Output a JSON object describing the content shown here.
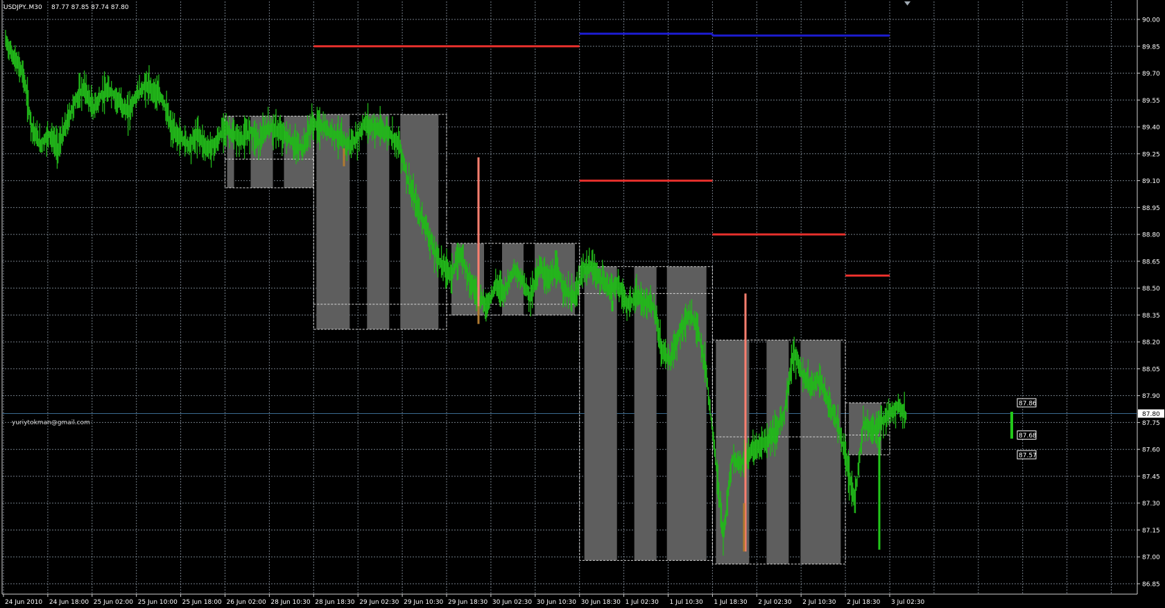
{
  "header": {
    "symbol": "USDJPY..M30",
    "quote": "87.77 87.85 87.74 87.80"
  },
  "watermark": "yuriytokman@gmail.com",
  "colors": {
    "background": "#000000",
    "grid": "#9aa7b5",
    "price_line": "#3a6a90",
    "candle": "#22b81a",
    "box_fill": "#5e5e5e",
    "level_red": "#e8302c",
    "level_blue": "#1c1cd0",
    "spike_red": "#ff7f6f",
    "spike_orange": "#b07a30",
    "spike_green": "#22c81a",
    "label_box": "#000000",
    "label_border": "#ffffff"
  },
  "chart_data": {
    "type": "candlestick",
    "title": "",
    "symbol": "USDJPY..M30",
    "ylim": [
      86.78,
      90.07
    ],
    "y_ticks": [
      90.0,
      89.85,
      89.7,
      89.55,
      89.4,
      89.25,
      89.1,
      88.95,
      88.8,
      88.65,
      88.5,
      88.35,
      88.2,
      88.05,
      87.9,
      87.75,
      87.6,
      87.45,
      87.3,
      87.15,
      87.0,
      86.85
    ],
    "y_tick_labels": [
      "90.00",
      "89.85",
      "89.70",
      "89.55",
      "89.40",
      "89.25",
      "89.10",
      "88.95",
      "88.80",
      "88.65",
      "88.50",
      "88.35",
      "88.20",
      "88.05",
      "87.90",
      "87.75",
      "87.60",
      "87.45",
      "87.30",
      "87.15",
      "87.00",
      "86.85"
    ],
    "x_labels": [
      "24 Jun 2010",
      "24 Jun 18:00",
      "25 Jun 02:00",
      "25 Jun 10:00",
      "25 Jun 18:00",
      "26 Jun 02:00",
      "28 Jun 10:30",
      "28 Jun 18:30",
      "29 Jun 02:30",
      "29 Jun 10:30",
      "29 Jun 18:30",
      "30 Jun 02:30",
      "30 Jun 10:30",
      "30 Jun 18:30",
      "1 Jul 02:30",
      "1 Jul 10:30",
      "1 Jul 18:30",
      "2 Jul 02:30",
      "2 Jul 10:30",
      "2 Jul 18:30",
      "3 Jul 02:30"
    ],
    "current_price": 87.8,
    "current_price_label": "87.80",
    "price_trace": [
      89.88,
      89.78,
      89.7,
      89.4,
      89.3,
      89.36,
      89.28,
      89.42,
      89.55,
      89.62,
      89.5,
      89.58,
      89.6,
      89.54,
      89.48,
      89.58,
      89.63,
      89.6,
      89.55,
      89.38,
      89.34,
      89.3,
      89.36,
      89.28,
      89.3,
      89.4,
      89.35,
      89.33,
      89.38,
      89.32,
      89.4,
      89.38,
      89.35,
      89.3,
      89.28,
      89.42,
      89.4,
      89.38,
      89.35,
      89.3,
      89.32,
      89.42,
      89.4,
      89.38,
      89.36,
      89.3,
      89.1,
      88.95,
      88.85,
      88.7,
      88.62,
      88.58,
      88.7,
      88.55,
      88.45,
      88.4,
      88.52,
      88.48,
      88.6,
      88.55,
      88.45,
      88.62,
      88.55,
      88.6,
      88.48,
      88.45,
      88.6,
      88.62,
      88.55,
      88.5,
      88.52,
      88.4,
      88.45,
      88.42,
      88.4,
      88.15,
      88.1,
      88.25,
      88.35,
      88.3,
      88.05,
      87.6,
      87.1,
      87.55,
      87.52,
      87.58,
      87.62,
      87.65,
      87.7,
      87.8,
      88.15,
      88.02,
      87.95,
      88.0,
      87.85,
      87.75,
      87.55,
      87.3,
      87.75,
      87.7,
      87.75,
      87.8,
      87.84,
      87.78
    ],
    "ranges": [
      {
        "from": "26 Jun 02:00",
        "to": "28 Jun 18:30",
        "high": 89.46,
        "low": 89.06,
        "mid": 89.22
      },
      {
        "from": "28 Jun 18:30",
        "to": "29 Jun 18:30",
        "high": 89.47,
        "low": 88.27,
        "mid": 88.41
      },
      {
        "from": "29 Jun 18:30",
        "to": "30 Jun 18:30",
        "high": 88.75,
        "low": 88.35,
        "mid": 88.41
      },
      {
        "from": "30 Jun 18:30",
        "to": "1 Jul 18:30",
        "high": 88.62,
        "low": 86.98,
        "mid": 88.47
      },
      {
        "from": "1 Jul 18:30",
        "to": "2 Jul 18:30",
        "high": 88.21,
        "low": 86.96,
        "mid": 87.67
      },
      {
        "from": "2 Jul 18:30",
        "to": "3 Jul 02:30",
        "high": 87.86,
        "low": 87.57,
        "mid": 87.68
      }
    ],
    "range_labels": [
      "87.86",
      "87.68",
      "87.57"
    ],
    "levels": [
      {
        "color": "red",
        "value": 89.85,
        "from": "28 Jun 18:30",
        "to": "30 Jun 18:30"
      },
      {
        "color": "blue",
        "value": 89.92,
        "from": "30 Jun 18:30",
        "to": "1 Jul 18:30"
      },
      {
        "color": "blue",
        "value": 89.91,
        "from": "1 Jul 18:30",
        "to": "3 Jul 02:30"
      },
      {
        "color": "red",
        "value": 89.1,
        "from": "30 Jun 18:30",
        "to": "1 Jul 18:30"
      },
      {
        "color": "red",
        "value": 88.8,
        "from": "1 Jul 18:30",
        "to": "2 Jul 18:30"
      },
      {
        "color": "red",
        "value": 88.57,
        "from": "2 Jul 18:30",
        "to": "3 Jul 02:30"
      }
    ]
  }
}
